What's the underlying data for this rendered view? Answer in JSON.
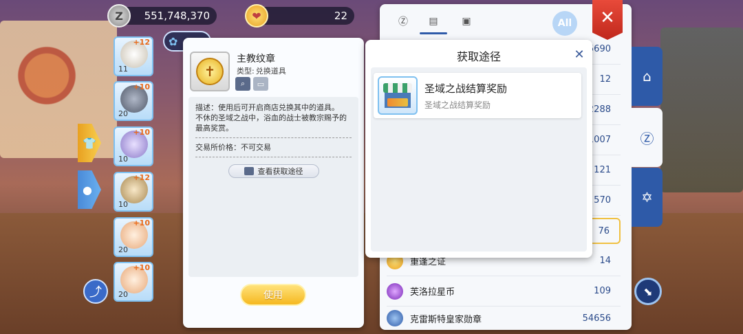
{
  "currency": {
    "zeny_symbol": "Z",
    "zeny_amount": "551,748,370",
    "gem_amount": "22"
  },
  "equipment": [
    {
      "refine": "+12",
      "level": "11",
      "icon": "skull-helmet-icon"
    },
    {
      "refine": "+10",
      "level": "20",
      "icon": "armor-icon"
    },
    {
      "refine": "+10",
      "level": "10",
      "icon": "shield-icon"
    },
    {
      "refine": "+12",
      "level": "10",
      "icon": "boots-icon"
    },
    {
      "refine": "+10",
      "level": "20",
      "icon": "necklace-icon"
    },
    {
      "refine": "+10",
      "level": "20",
      "icon": "necklace-icon"
    }
  ],
  "item_detail": {
    "name": "主教纹章",
    "type_label": "类型:",
    "type_value": "兑换道具",
    "description": "描述：使用后可开启商店兑换其中的道具。",
    "flavor": "不休的圣域之战中，浴血的战士被教宗赐予的最高奖赏。",
    "trade_price": "交易所价格：不可交易",
    "view_source_label": "查看获取途径",
    "use_label": "使用"
  },
  "bag_panel": {
    "all_label": "All",
    "rows": [
      {
        "name": "",
        "count": "5690",
        "icon": "",
        "highlight": false
      },
      {
        "name": "",
        "count": "12",
        "icon": "",
        "highlight": false
      },
      {
        "name": "",
        "count": "2288",
        "icon": "",
        "highlight": false
      },
      {
        "name": "",
        "count": "1007",
        "icon": "",
        "highlight": false
      },
      {
        "name": "",
        "count": "121",
        "icon": "",
        "highlight": false
      },
      {
        "name": "",
        "count": "570",
        "icon": "",
        "highlight": false
      },
      {
        "name": "",
        "count": "76",
        "icon": "",
        "highlight": true
      },
      {
        "name": "重逢之证",
        "count": "14",
        "icon": "token-icon",
        "highlight": false
      },
      {
        "name": "芙洛拉星币",
        "count": "109",
        "icon": "star-coin-icon",
        "highlight": false
      },
      {
        "name": "克雷斯特皇家勋章",
        "count": "54656",
        "icon": "medal-icon",
        "highlight": false
      }
    ]
  },
  "route_popup": {
    "title": "获取途径",
    "item_title": "圣域之战结算奖励",
    "item_sub": "圣域之战结算奖励"
  },
  "colors": {
    "accent_blue": "#2e5aa8",
    "close_red": "#d8382a",
    "use_gold": "#f5b820"
  }
}
